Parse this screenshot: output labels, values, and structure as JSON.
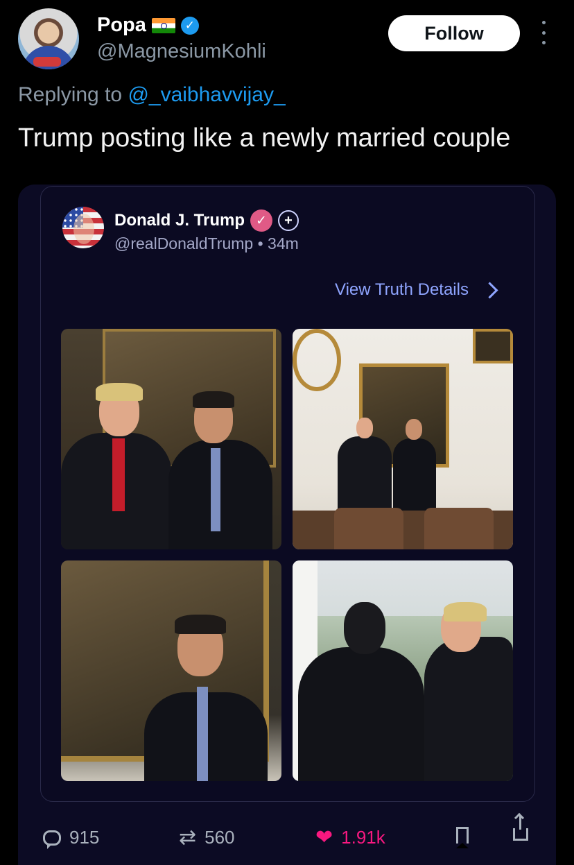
{
  "tweet": {
    "author_name": "Popa",
    "author_handle": "@MagnesiumKohli",
    "follow_label": "Follow",
    "replying_prefix": "Replying to",
    "replying_to": "@_vaibhavvijay_",
    "text": "Trump posting like a newly married couple"
  },
  "embed": {
    "author_name": "Donald J. Trump",
    "author_handle": "@realDonaldTrump",
    "separator": "•",
    "time": "34m",
    "view_details_label": "View Truth Details",
    "photos": [
      {
        "icon": "photo"
      },
      {
        "icon": "photo"
      },
      {
        "icon": "photo"
      },
      {
        "icon": "photo"
      }
    ]
  },
  "actions": {
    "replies": "915",
    "retweets": "560",
    "likes": "1.91k"
  },
  "colors": {
    "background": "#000000",
    "card": "#0c0b24",
    "accent_blue": "#1d9bf0",
    "link_purple": "#8fa5ff",
    "like_pink": "#f91880",
    "truth_badge": "#e05a86"
  }
}
